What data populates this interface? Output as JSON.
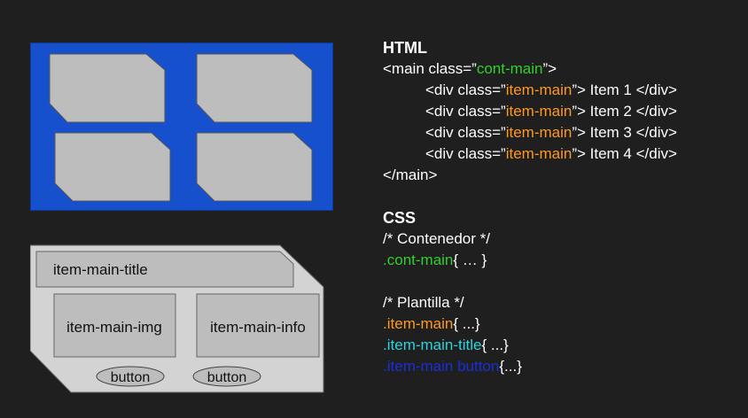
{
  "diagram": {
    "grid_colors": {
      "container": "#1750cc",
      "item": "#bdbdbd"
    },
    "card": {
      "title": "item-main-title",
      "img": "item-main-img",
      "info": "item-main-info",
      "buttons": [
        "button",
        "button"
      ]
    }
  },
  "html_code": {
    "heading": "HTML",
    "open_main_prefix": "<main class=”",
    "open_main_class": "cont-main",
    "open_main_suffix": "”>",
    "items": [
      {
        "prefix": "<div class=”",
        "cls": "item-main",
        "suffix": "”> Item 1 </div>"
      },
      {
        "prefix": "<div class=”",
        "cls": "item-main",
        "suffix": "”> Item 2 </div>"
      },
      {
        "prefix": "<div class=”",
        "cls": "item-main",
        "suffix": "”> Item 3 </div>"
      },
      {
        "prefix": "<div class=”",
        "cls": "item-main",
        "suffix": "”> Item 4 </div>"
      }
    ],
    "close_main": "</main>"
  },
  "css_code": {
    "heading": "CSS",
    "comment_container": "/* Contenedor */",
    "cont_dot": ".",
    "cont_class": "cont-main",
    "cont_rest": "{ … }",
    "comment_template": "/* Plantilla */",
    "rules": [
      {
        "dot": ".",
        "cls": "item-main",
        "rest": "{ ...}",
        "color": "orange"
      },
      {
        "dot": ".",
        "cls": "item-main-title",
        "rest": "{ ...}",
        "color": "cyan"
      },
      {
        "dot": ".",
        "cls": "item-main button",
        "rest": "{...}",
        "color": "blue"
      }
    ]
  },
  "colors": {
    "background": "#1f1f1f",
    "green": "#2fd12a",
    "orange": "#ff9a1f",
    "cyan": "#29d4dd",
    "blue": "#1a2fd9"
  }
}
